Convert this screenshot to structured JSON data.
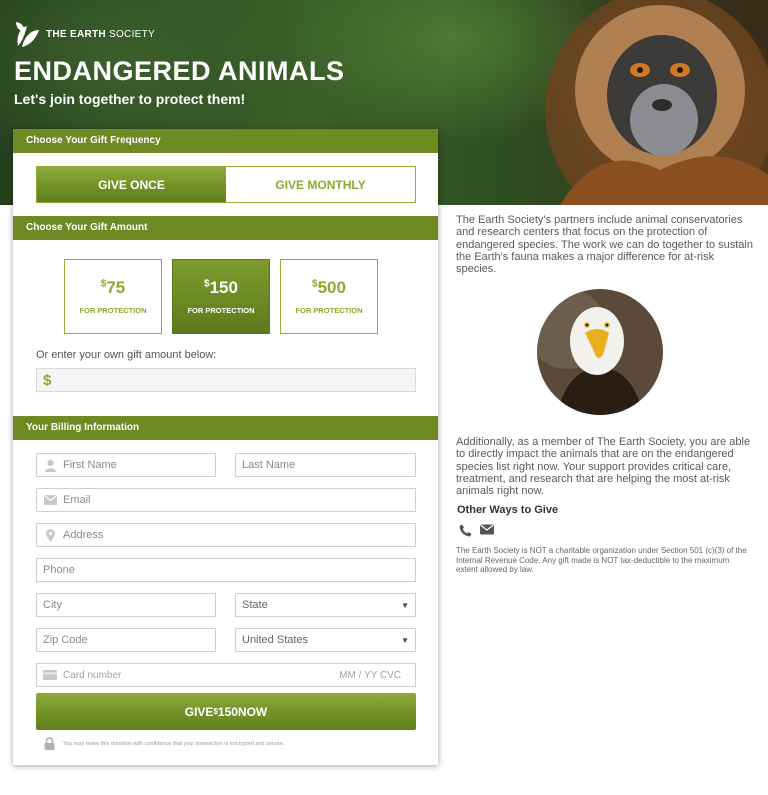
{
  "brand": {
    "logo_text_bold": "THE EARTH",
    "logo_text_light": " SOCIETY"
  },
  "hero": {
    "title": "ENDANGERED ANIMALS",
    "subtitle": "Let's join together to protect them!"
  },
  "frequency": {
    "header": "Choose Your Gift Frequency",
    "options": [
      {
        "label": "GIVE ONCE",
        "selected": true
      },
      {
        "label": "GIVE MONTHLY",
        "selected": false
      }
    ]
  },
  "amount": {
    "header": "Choose Your Gift Amount",
    "options": [
      {
        "currency": "$",
        "value": "75",
        "caption": "FOR PROTECTION",
        "selected": false
      },
      {
        "currency": "$",
        "value": "150",
        "caption": "FOR PROTECTION",
        "selected": true
      },
      {
        "currency": "$",
        "value": "500",
        "caption": "FOR PROTECTION",
        "selected": false
      }
    ],
    "own_label": "Or enter your own gift amount below:",
    "own_prefix": "$"
  },
  "billing": {
    "header": "Your Billing Information",
    "first_name": "First Name",
    "last_name": "Last Name",
    "email": "Email",
    "address": "Address",
    "phone": "Phone",
    "city": "City",
    "state": "State",
    "zip": "Zip Code",
    "country": "United States",
    "card_number": "Card number",
    "card_extra": "MM / YY  CVC"
  },
  "submit": {
    "prefix": "GIVE ",
    "currency": "$",
    "amount": "150",
    "suffix": " NOW"
  },
  "secure_note": "You may make this donation with confidence that your transaction is encrypted and secure.",
  "info": {
    "paragraph1": "The Earth Society's partners include animal conservatories and research centers that focus on the protection of endangered species. The work we can do together to sustain the Earth's fauna makes a major difference for at-risk species.",
    "paragraph2": "Additionally, as a member of The Earth Society, you are able to directly impact the animals that are on the endangered species list right now. Your support provides critical care, treatment, and research that are helping the most at-risk animals right now.",
    "other_ways": "Other Ways to Give",
    "legal": "The Earth Society is NOT a charitable organization under Section 501 (c)(3) of the Internal Revenue Code. Any gift made is NOT tax-deductible to the maximum extent allowed by law."
  },
  "colors": {
    "accent": "#6e8a22",
    "accent_light": "#8bab2f"
  }
}
